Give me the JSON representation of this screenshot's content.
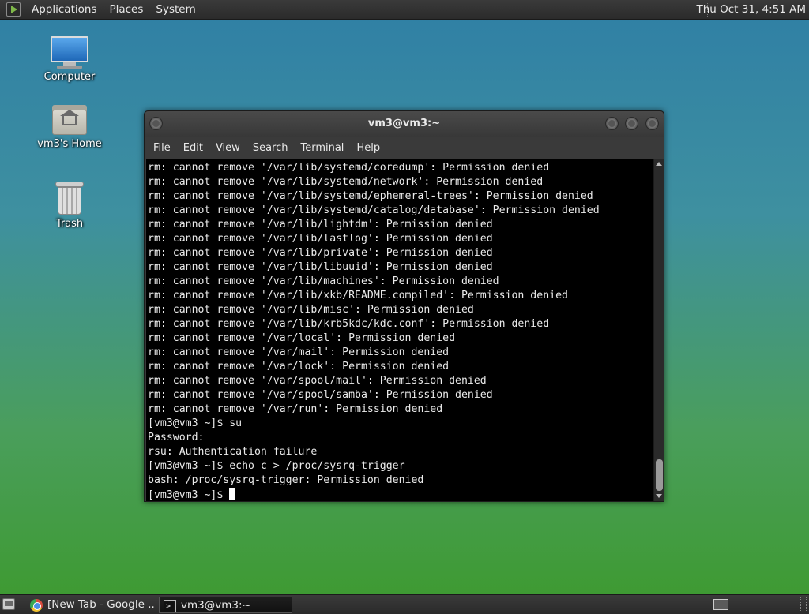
{
  "top_panel": {
    "menus": [
      "Applications",
      "Places",
      "System"
    ],
    "clock": "Thu Oct 31,  4:51 AM"
  },
  "desktop": {
    "icons": [
      {
        "label": "Computer",
        "icon": "computer-icon"
      },
      {
        "label": "vm3's Home",
        "icon": "home-folder-icon"
      },
      {
        "label": "Trash",
        "icon": "trash-icon"
      }
    ]
  },
  "terminal_window": {
    "title": "vm3@vm3:~",
    "menu": [
      "File",
      "Edit",
      "View",
      "Search",
      "Terminal",
      "Help"
    ],
    "lines": [
      "rm: cannot remove '/var/lib/systemd/coredump': Permission denied",
      "rm: cannot remove '/var/lib/systemd/network': Permission denied",
      "rm: cannot remove '/var/lib/systemd/ephemeral-trees': Permission denied",
      "rm: cannot remove '/var/lib/systemd/catalog/database': Permission denied",
      "rm: cannot remove '/var/lib/lightdm': Permission denied",
      "rm: cannot remove '/var/lib/lastlog': Permission denied",
      "rm: cannot remove '/var/lib/private': Permission denied",
      "rm: cannot remove '/var/lib/libuuid': Permission denied",
      "rm: cannot remove '/var/lib/machines': Permission denied",
      "rm: cannot remove '/var/lib/xkb/README.compiled': Permission denied",
      "rm: cannot remove '/var/lib/misc': Permission denied",
      "rm: cannot remove '/var/lib/krb5kdc/kdc.conf': Permission denied",
      "rm: cannot remove '/var/local': Permission denied",
      "rm: cannot remove '/var/mail': Permission denied",
      "rm: cannot remove '/var/lock': Permission denied",
      "rm: cannot remove '/var/spool/mail': Permission denied",
      "rm: cannot remove '/var/spool/samba': Permission denied",
      "rm: cannot remove '/var/run': Permission denied",
      "[vm3@vm3 ~]$ su",
      "Password:",
      "rsu: Authentication failure",
      "[vm3@vm3 ~]$ echo c > /proc/sysrq-trigger",
      "bash: /proc/sysrq-trigger: Permission denied"
    ],
    "prompt": "[vm3@vm3 ~]$ "
  },
  "taskbar": {
    "tasks": [
      {
        "label": "[New Tab - Google ...",
        "icon": "chrome-icon",
        "active": false
      },
      {
        "label": "vm3@vm3:~",
        "icon": "terminal-icon",
        "active": true
      }
    ]
  }
}
